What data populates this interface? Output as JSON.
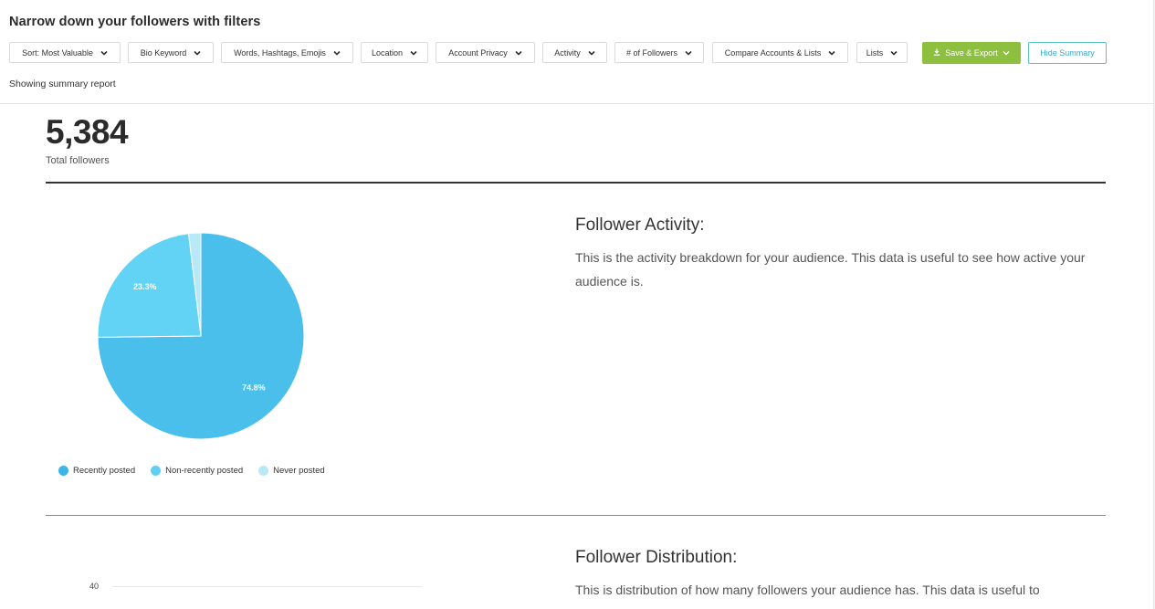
{
  "header": {
    "title": "Narrow down your followers with filters",
    "status": "Showing summary report"
  },
  "filters": [
    {
      "label": "Sort: Most Valuable"
    },
    {
      "label": "Bio Keyword"
    },
    {
      "label": "Words, Hashtags, Emojis"
    },
    {
      "label": "Location"
    },
    {
      "label": "Account Privacy"
    },
    {
      "label": "Activity"
    },
    {
      "label": "# of Followers"
    },
    {
      "label": "Compare Accounts & Lists"
    },
    {
      "label": "Lists"
    }
  ],
  "actions": {
    "save_export": "Save & Export",
    "hide_summary": "Hide Summary",
    "save_color": "#8dc03f",
    "hide_color": "#3ba9c6"
  },
  "summary": {
    "total_value": "5,384",
    "total_label": "Total followers"
  },
  "activity_section": {
    "title": "Follower Activity:",
    "description": "This is the activity breakdown for your audience. This data is useful to see how active your audience is."
  },
  "distribution_section": {
    "title": "Follower Distribution:",
    "description": "This is distribution of how many followers your audience has. This data is useful to",
    "axis_tick": "40"
  },
  "chart_data": {
    "type": "pie",
    "title": "Follower Activity",
    "legend_position": "bottom",
    "slices": [
      {
        "label": "Recently posted",
        "value": 74.8,
        "display": "74.8%",
        "color": "#4bbfec"
      },
      {
        "label": "Non-recently posted",
        "value": 23.3,
        "display": "23.3%",
        "color": "#62d3f5"
      },
      {
        "label": "Never posted",
        "value": 1.9,
        "display": "",
        "color": "#b9e9f7"
      }
    ]
  }
}
